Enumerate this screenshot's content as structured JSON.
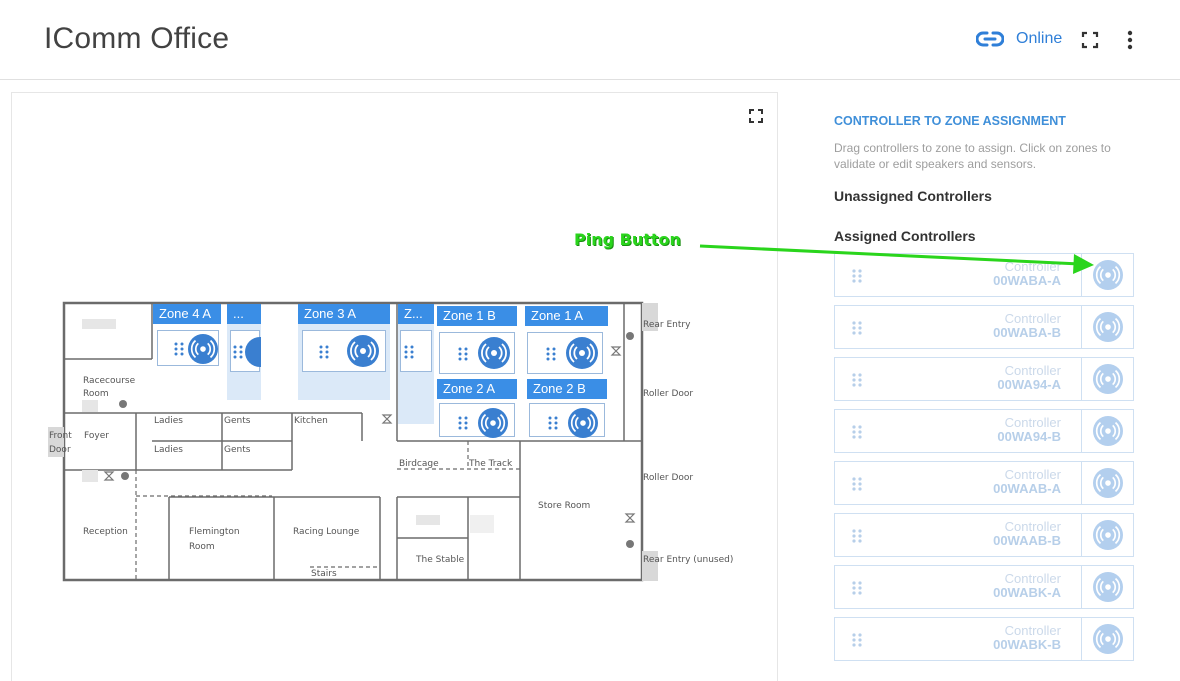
{
  "header": {
    "title": "IComm Office",
    "status": "Online",
    "icons": {
      "link": "link-icon",
      "fullscreen": "fullscreen-icon",
      "more": "more-vertical-icon"
    }
  },
  "map": {
    "rooms": {
      "racecourse_1": "Racecourse",
      "racecourse_2": "Room",
      "ladies_1": "Ladies",
      "gents_1": "Gents",
      "kitchen": "Kitchen",
      "front_1": "Front",
      "front_2": "Door",
      "foyer": "Foyer",
      "ladies_2": "Ladies",
      "gents_2": "Gents",
      "birdcage": "Birdcage",
      "the_track": "The Track",
      "reception": "Reception",
      "flemington_1": "Flemington",
      "flemington_2": "Room",
      "racing_lounge": "Racing Lounge",
      "stairs": "Stairs",
      "the_stable": "The Stable",
      "store_room": "Store Room",
      "rear_entry": "Rear Entry",
      "roller_door_1": "Roller Door",
      "roller_door_2": "Roller Door",
      "rear_entry_unused": "Rear Entry (unused)"
    },
    "zones": [
      {
        "label": "Zone 4 A"
      },
      {
        "label": "..."
      },
      {
        "label": "Zone 3 A"
      },
      {
        "label": "Z..."
      },
      {
        "label": "Zone 1 B"
      },
      {
        "label": "Zone 1 A"
      },
      {
        "label": "Zone 2 A"
      },
      {
        "label": "Zone 2 B"
      }
    ]
  },
  "panel": {
    "title": "CONTROLLER TO ZONE ASSIGNMENT",
    "description": "Drag controllers to zone to assign. Click on zones to validate or edit speakers and sensors.",
    "unassigned_heading": "Unassigned Controllers",
    "assigned_heading": "Assigned Controllers",
    "controllers": [
      {
        "line1": "Controller",
        "line2": "00WABA-A"
      },
      {
        "line1": "Controller",
        "line2": "00WABA-B"
      },
      {
        "line1": "Controller",
        "line2": "00WA94-A"
      },
      {
        "line1": "Controller",
        "line2": "00WA94-B"
      },
      {
        "line1": "Controller",
        "line2": "00WAAB-A"
      },
      {
        "line1": "Controller",
        "line2": "00WAAB-B"
      },
      {
        "line1": "Controller",
        "line2": "00WABK-A"
      },
      {
        "line1": "Controller",
        "line2": "00WABK-B"
      }
    ]
  },
  "annotation": {
    "label": "Ping Button",
    "color": "#2ad51c"
  },
  "colors": {
    "accent": "#3a8ee6",
    "zone_fill": "#dbe9f8",
    "wall": "#666666"
  }
}
